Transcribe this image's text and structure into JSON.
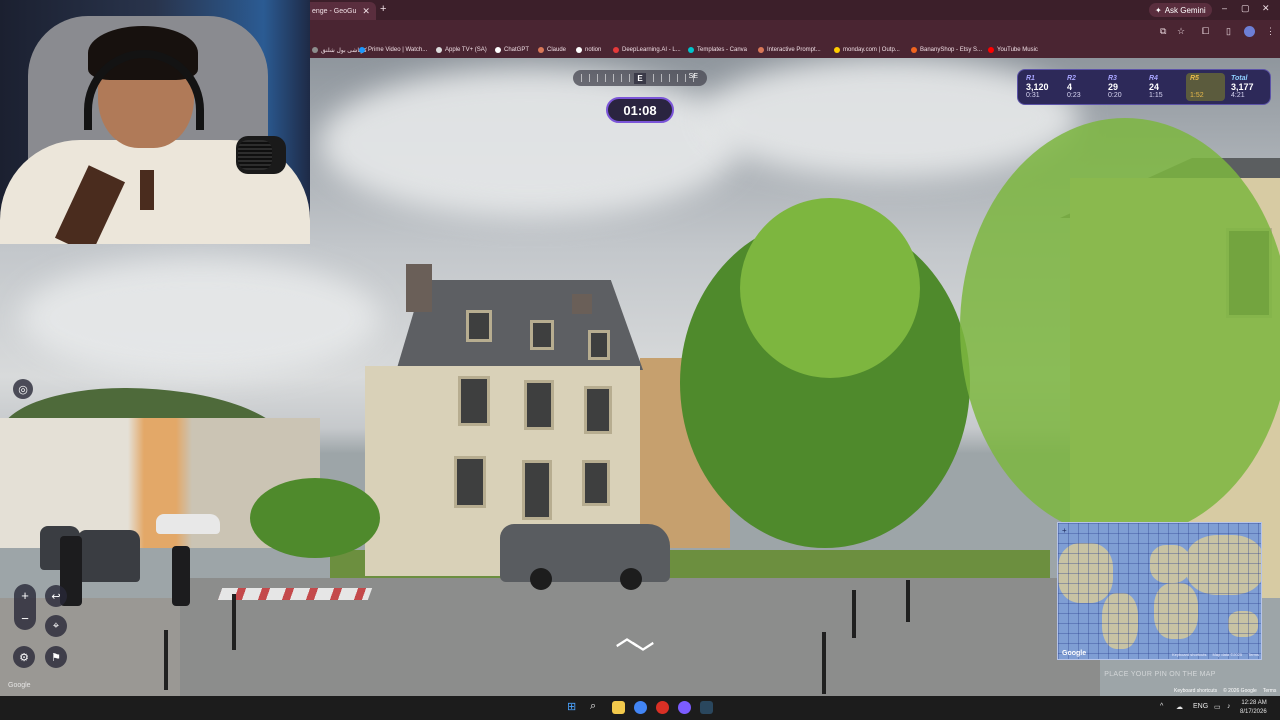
{
  "browser": {
    "tab_title": "enge - GeoGu",
    "tab_close": "✕",
    "new_tab": "+",
    "ask_gemini": "Ask Gemini",
    "window_controls": [
      "–",
      "▢",
      "✕"
    ],
    "toolbar_icons": [
      "cast-icon",
      "star-icon",
      "extensions-icon",
      "sidebar-icon",
      "menu-icon"
    ],
    "bookmarks": [
      {
        "label": "كرتاشى بول شلنق",
        "color": "#8d8d8d"
      },
      {
        "label": "Prime Video | Watch...",
        "color": "#1a98ff"
      },
      {
        "label": "Apple TV+ (SA)",
        "color": "#dddddd"
      },
      {
        "label": "ChatGPT",
        "color": "#ffffff"
      },
      {
        "label": "Claude",
        "color": "#d97757"
      },
      {
        "label": "notion",
        "color": "#ffffff"
      },
      {
        "label": "DeepLearning.AI - L...",
        "color": "#e5393a"
      },
      {
        "label": "Templates - Canva",
        "color": "#00c4cc"
      },
      {
        "label": "Interactive Prompt...",
        "color": "#d97757"
      },
      {
        "label": "monday.com | Outp...",
        "color": "#ffcc00"
      },
      {
        "label": "BananyShop - Etsy S...",
        "color": "#f1641e"
      },
      {
        "label": "YouTube Music",
        "color": "#ff0000"
      }
    ]
  },
  "game": {
    "compass": {
      "heading": "E",
      "next": "SE"
    },
    "timer": "01:08",
    "scoreboard": [
      {
        "label": "R1",
        "score": "3,120",
        "time": "0:31",
        "active": false
      },
      {
        "label": "R2",
        "score": "4",
        "time": "0:23",
        "active": false
      },
      {
        "label": "R3",
        "score": "29",
        "time": "0:20",
        "active": false
      },
      {
        "label": "R4",
        "score": "24",
        "time": "1:15",
        "active": false
      },
      {
        "label": "R5",
        "score": "",
        "time": "1:52",
        "active": true
      },
      {
        "label": "Total",
        "score": "3,177",
        "time": "4:21",
        "active": false
      }
    ],
    "controls": {
      "zoom_in": "+",
      "zoom_out": "−",
      "undo": "↩",
      "settings_icon": "gear-icon",
      "flag_icon": "flag-icon",
      "pin_icon": "pin-icon",
      "shield_icon": "location-icon"
    },
    "minimap": {
      "provider": "Google",
      "credits": [
        "Keyboard shortcuts",
        "Map data ©2025",
        "Terms"
      ],
      "hint": "PLACE YOUR PIN ON THE MAP"
    },
    "streetview_credits": [
      "Keyboard shortcuts",
      "© 2026 Google",
      "Terms"
    ],
    "streetview_google": "Google"
  },
  "taskbar": {
    "tray_lang": "ENG",
    "time": "12:28 AM",
    "date": "8/17/2026"
  }
}
